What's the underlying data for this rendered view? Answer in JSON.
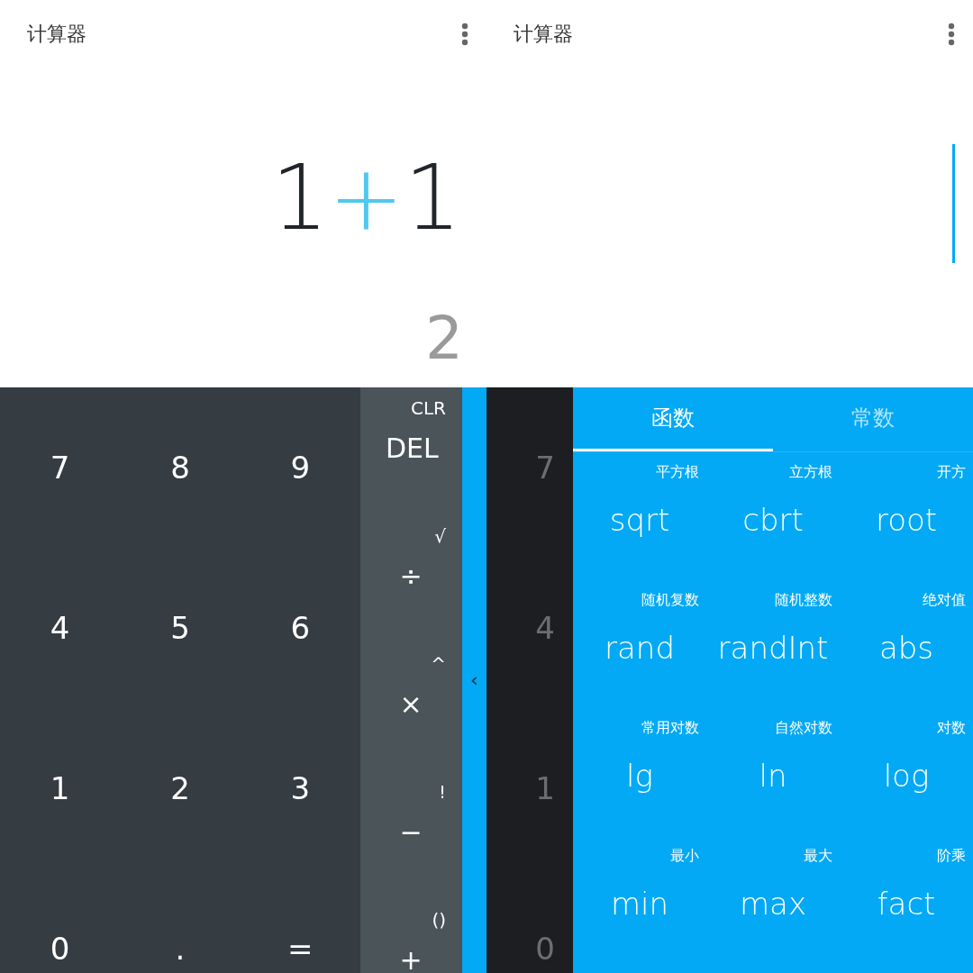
{
  "screens": [
    {
      "title": "计算器",
      "expression": [
        {
          "text": "1",
          "kind": "digit"
        },
        {
          "text": "+",
          "kind": "operator"
        },
        {
          "text": "1",
          "kind": "digit"
        }
      ],
      "result": "2",
      "keypad": {
        "digit_rows": [
          [
            "7",
            "8",
            "9"
          ],
          [
            "4",
            "5",
            "6"
          ],
          [
            "1",
            "2",
            "3"
          ],
          [
            "0",
            ".",
            "="
          ]
        ],
        "operators": [
          {
            "main": "DEL",
            "secondary": "CLR"
          },
          {
            "main": "÷",
            "secondary": "√"
          },
          {
            "main": "×",
            "secondary": "^"
          },
          {
            "main": "−",
            "secondary": "!"
          },
          {
            "main": "+",
            "secondary": "()"
          }
        ],
        "drawer_handle": "‹"
      }
    },
    {
      "title": "计算器",
      "cursor": true,
      "keypad": {
        "digit_column": [
          "7",
          "4",
          "1",
          "0"
        ],
        "tabs": [
          {
            "label": "函数",
            "selected": true
          },
          {
            "label": "常数",
            "selected": false
          }
        ],
        "functions": [
          {
            "name": "sqrt",
            "caption": "平方根"
          },
          {
            "name": "cbrt",
            "caption": "立方根"
          },
          {
            "name": "root",
            "caption": "开方"
          },
          {
            "name": "rand",
            "caption": "随机复数"
          },
          {
            "name": "randInt",
            "caption": "随机整数"
          },
          {
            "name": "abs",
            "caption": "绝对值"
          },
          {
            "name": "lg",
            "caption": "常用对数"
          },
          {
            "name": "ln",
            "caption": "自然对数"
          },
          {
            "name": "log",
            "caption": "对数"
          },
          {
            "name": "min",
            "caption": "最小"
          },
          {
            "name": "max",
            "caption": "最大"
          },
          {
            "name": "fact",
            "caption": "阶乘"
          }
        ]
      }
    }
  ]
}
